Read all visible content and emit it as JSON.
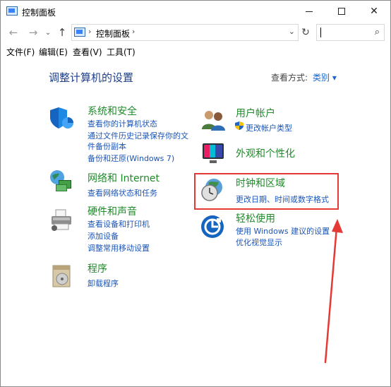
{
  "window": {
    "title": "控制面板",
    "minimize": "—",
    "maximize": "□",
    "close": "✕"
  },
  "nav": {
    "back": "←",
    "forward": "→",
    "history": "⌄",
    "up": "↑",
    "address_sep": "›",
    "address_text": "控制面板",
    "address_dropdown": "⌄",
    "refresh": "↻",
    "search_icon": "⌕"
  },
  "menu": {
    "file": "文件(F)",
    "edit": "编辑(E)",
    "view": "查看(V)",
    "tools": "工具(T)"
  },
  "content": {
    "title": "调整计算机的设置",
    "view_by_label": "查看方式:",
    "view_by_value": "类别 ▾"
  },
  "categories": {
    "system": {
      "title": "系统和安全",
      "links": [
        "查看你的计算机状态",
        "通过文件历史记录保存你的文",
        "件备份副本",
        "备份和还原(Windows 7)"
      ]
    },
    "network": {
      "title": "网络和 Internet",
      "links": [
        "查看网络状态和任务"
      ]
    },
    "hardware": {
      "title": "硬件和声音",
      "links": [
        "查看设备和打印机",
        "添加设备",
        "调整常用移动设置"
      ]
    },
    "programs": {
      "title": "程序",
      "links": [
        "卸载程序"
      ]
    },
    "users": {
      "title": "用户帐户",
      "links": [
        "更改帐户类型"
      ]
    },
    "appearance": {
      "title": "外观和个性化",
      "links": []
    },
    "clock": {
      "title": "时钟和区域",
      "links": [
        "更改日期、时间或数字格式"
      ]
    },
    "ease": {
      "title": "轻松使用",
      "links": [
        "使用 Windows 建议的设置",
        "优化视觉显示"
      ]
    }
  },
  "colors": {
    "category_title": "#1f8a2a",
    "link": "#1a55b8",
    "highlight": "#e53935"
  }
}
